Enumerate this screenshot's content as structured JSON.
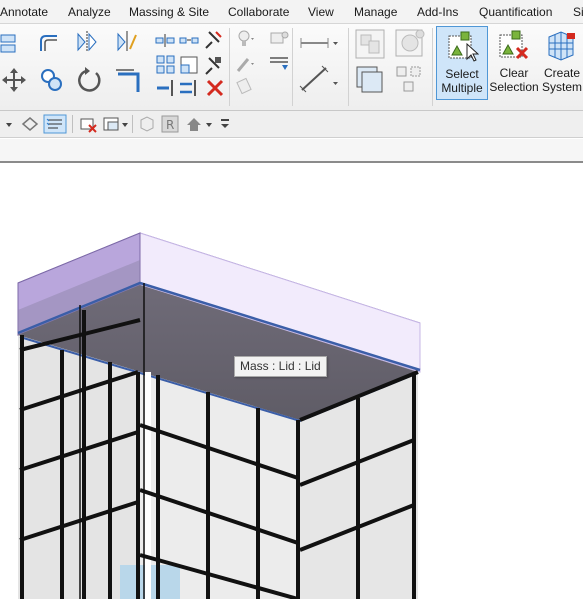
{
  "ribbon_tabs": [
    "Annotate",
    "Analyze",
    "Massing & Site",
    "Collaborate",
    "View",
    "Manage",
    "Add-Ins",
    "Quantification",
    "Si"
  ],
  "select_multiple": {
    "line1": "Select",
    "line2": "Multiple"
  },
  "clear_selection": {
    "line1": "Clear",
    "line2": "Selection"
  },
  "create_system": {
    "line1": "Create",
    "line2": "System"
  },
  "tooltip": "Mass : Lid : Lid",
  "colors": {
    "mass_fill": "#b9a6dc",
    "selection_blue": "#3b5ea8",
    "delete_red": "#d42a1f",
    "ribbon_accent": "#2a7fd4"
  }
}
